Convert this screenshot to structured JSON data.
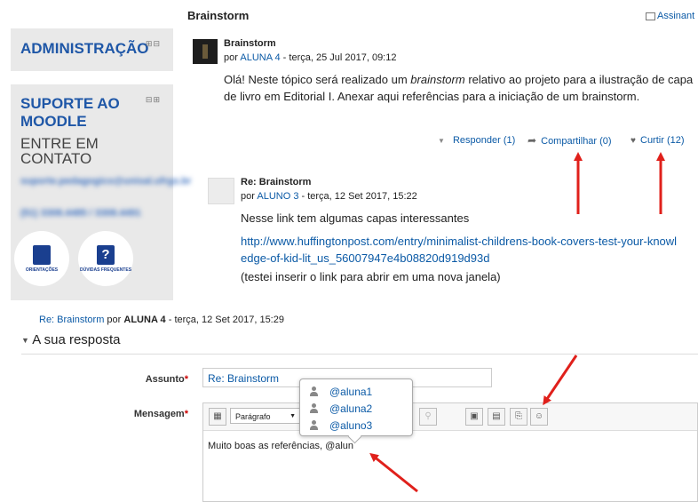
{
  "header": {
    "discussion_title": "Brainstorm",
    "subscribe_label": "Assinant"
  },
  "sidebar": {
    "admin_block": {
      "title": "ADMINISTRAÇÃO",
      "controls": "+□"
    },
    "support_block": {
      "title": "SUPORTE AO MOODLE",
      "subtitle": "ENTRE EM CONTATO",
      "email_blurred": "suporte.pedagogico@unisal.ufrgs.br",
      "phone_blurred": "(51) 3308.4485 / 3308.4491",
      "controls": "−□",
      "btn_guides_label": "ORIENTAÇÕES",
      "btn_faq_label": "DÚVIDAS FREQUENTES"
    }
  },
  "post_main": {
    "subject": "Brainstorm",
    "by": "por",
    "author": "ALUNA 4",
    "date": "- terça, 25 Jul 2017, 09:12",
    "body_before": "Olá! Neste tópico será realizado um ",
    "body_em": "brainstorm",
    "body_after": " relativo ao projeto para a ilustração de capa de livro em Editorial I. Anexar aqui referências para a iniciação de um brainstorm.",
    "actions": {
      "reply": "Responder (1)",
      "share": "Compartilhar (0)",
      "like": "Curtir (12)"
    }
  },
  "post_reply": {
    "subject": "Re: Brainstorm",
    "by": "por",
    "author": "ALUNO 3",
    "date": "- terça, 12 Set 2017, 15:22",
    "line1": "Nesse link tem algumas capas interessantes",
    "link": "http://www.huffingtonpost.com/entry/minimalist-childrens-book-covers-test-your-knowledge-of-kid-lit_us_56007947e4b08820d919d93d",
    "note": "(testei inserir o link para abrir em uma nova janela)"
  },
  "reply_context": {
    "link": "Re: Brainstorm",
    "by": "por",
    "author": "ALUNA 4",
    "date": "- terça, 12 Set 2017, 15:29"
  },
  "form": {
    "section_title": "A sua resposta",
    "subject_label": "Assunto",
    "subject_value": "Re: Brainstorm",
    "message_label": "Mensagem",
    "format_select": "Parágrafo",
    "message_text": "Muito boas as referências, @alun",
    "required_mark": "*"
  },
  "mention_popup": {
    "users": [
      "@aluna1",
      "@aluna2",
      "@aluno3"
    ]
  },
  "colors": {
    "link": "#0b5aa6",
    "annotation_arrow": "#e0201b",
    "sidebar_bg": "#e9e9e9",
    "block_title": "#1f57a7"
  }
}
